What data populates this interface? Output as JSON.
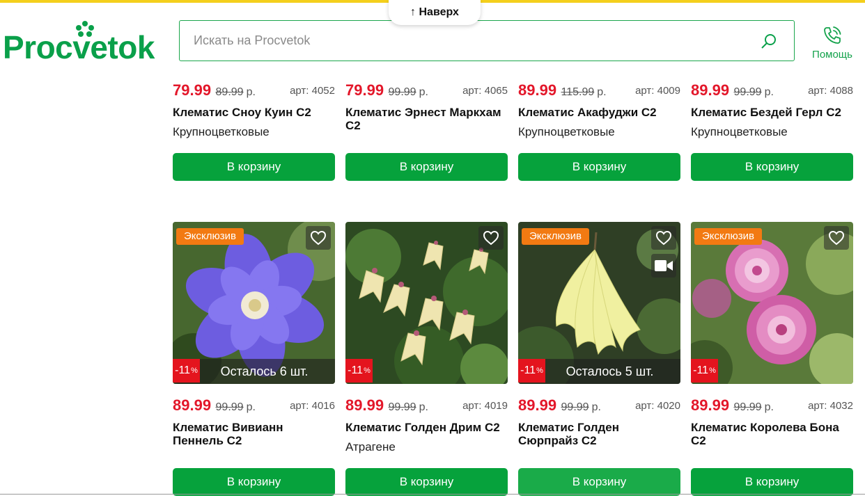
{
  "header": {
    "to_top_label": "↑ Наверх",
    "logo_text": "Procvetok",
    "search_placeholder": "Искать на Procvetok",
    "help_label": "Помощь"
  },
  "colors": {
    "brand_green": "#0aa04a",
    "button_green": "#06a23c",
    "price_red": "#e3172a",
    "exclusive_orange": "#f27a12",
    "discount_red": "#e4141e",
    "top_bar_yellow": "#f4cf1c"
  },
  "row1": [
    {
      "price": "79.99",
      "old_price": "89.99",
      "currency": "р.",
      "art": "арт: 4052",
      "name": "Клематис Сноу Куин С2",
      "category": "Крупноцветковые",
      "button": "В корзину"
    },
    {
      "price": "79.99",
      "old_price": "99.99",
      "currency": "р.",
      "art": "арт: 4065",
      "name": "Клематис Эрнест Маркхам С2",
      "category": "",
      "button": "В корзину"
    },
    {
      "price": "89.99",
      "old_price": "115.99",
      "currency": "р.",
      "art": "арт: 4009",
      "name": "Клематис Акафуджи С2",
      "category": "Крупноцветковые",
      "button": "В корзину"
    },
    {
      "price": "89.99",
      "old_price": "99.99",
      "currency": "р.",
      "art": "арт: 4088",
      "name": "Клематис Бездей Герл С2",
      "category": "Крупноцветковые",
      "button": "В корзину"
    }
  ],
  "row2": [
    {
      "badge": "Эксклюзив",
      "discount": "-11",
      "discount_unit": "%",
      "stock": "Осталось 6 шт.",
      "video": false,
      "price": "89.99",
      "old_price": "99.99",
      "currency": "р.",
      "art": "арт: 4016",
      "name": "Клематис Вивианн Пеннель С2",
      "category": "",
      "button": "В корзину",
      "image": "purple-clematis-photo"
    },
    {
      "badge": "",
      "discount": "-11",
      "discount_unit": "%",
      "stock": "",
      "video": false,
      "price": "89.99",
      "old_price": "99.99",
      "currency": "р.",
      "art": "арт: 4019",
      "name": "Клематис Голден Дрим С2",
      "category": "Атрагене",
      "button": "В корзину",
      "image": "cream-bell-clematis-photo"
    },
    {
      "badge": "Эксклюзив",
      "discount": "-11",
      "discount_unit": "%",
      "stock": "Осталось 5 шт.",
      "video": true,
      "price": "89.99",
      "old_price": "99.99",
      "currency": "р.",
      "art": "арт: 4020",
      "name": "Клематис Голден Сюрпрайз С2",
      "category": "",
      "button": "В корзину",
      "image": "yellow-clematis-photo"
    },
    {
      "badge": "Эксклюзив",
      "discount": "-11",
      "discount_unit": "%",
      "stock": "",
      "video": false,
      "price": "89.99",
      "old_price": "99.99",
      "currency": "р.",
      "art": "арт: 4032",
      "name": "Клематис Королева Бона С2",
      "category": "",
      "button": "В корзину",
      "image": "pink-double-clematis-photo"
    }
  ]
}
